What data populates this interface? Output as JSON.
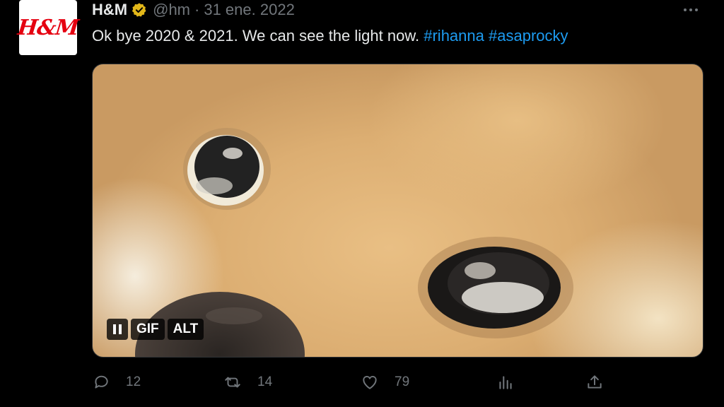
{
  "tweet": {
    "author_logo_text": "H&M",
    "author_name": "H&M",
    "handle": "@hm",
    "separator": "·",
    "date": "31 ene. 2022",
    "text_plain": "Ok bye 2020 & 2021. We can see the light now.",
    "hashtags": [
      "#rihanna",
      "#asaprocky"
    ]
  },
  "media": {
    "subject": "shiba-inu-close-up",
    "gif_label": "GIF",
    "alt_label": "ALT"
  },
  "actions": {
    "replies": "12",
    "retweets": "14",
    "likes": "79"
  },
  "colors": {
    "background": "#000000",
    "text": "#e7e9ea",
    "muted": "#71767b",
    "link": "#1d9bf0",
    "verified_gold": "#e2b719",
    "brand_red": "#e50010"
  },
  "icons": {
    "verified": "verified-badge-icon",
    "more": "more-options-icon",
    "reply": "reply-icon",
    "retweet": "retweet-icon",
    "like": "heart-icon",
    "views": "views-icon",
    "share": "share-icon",
    "pause": "pause-icon"
  }
}
